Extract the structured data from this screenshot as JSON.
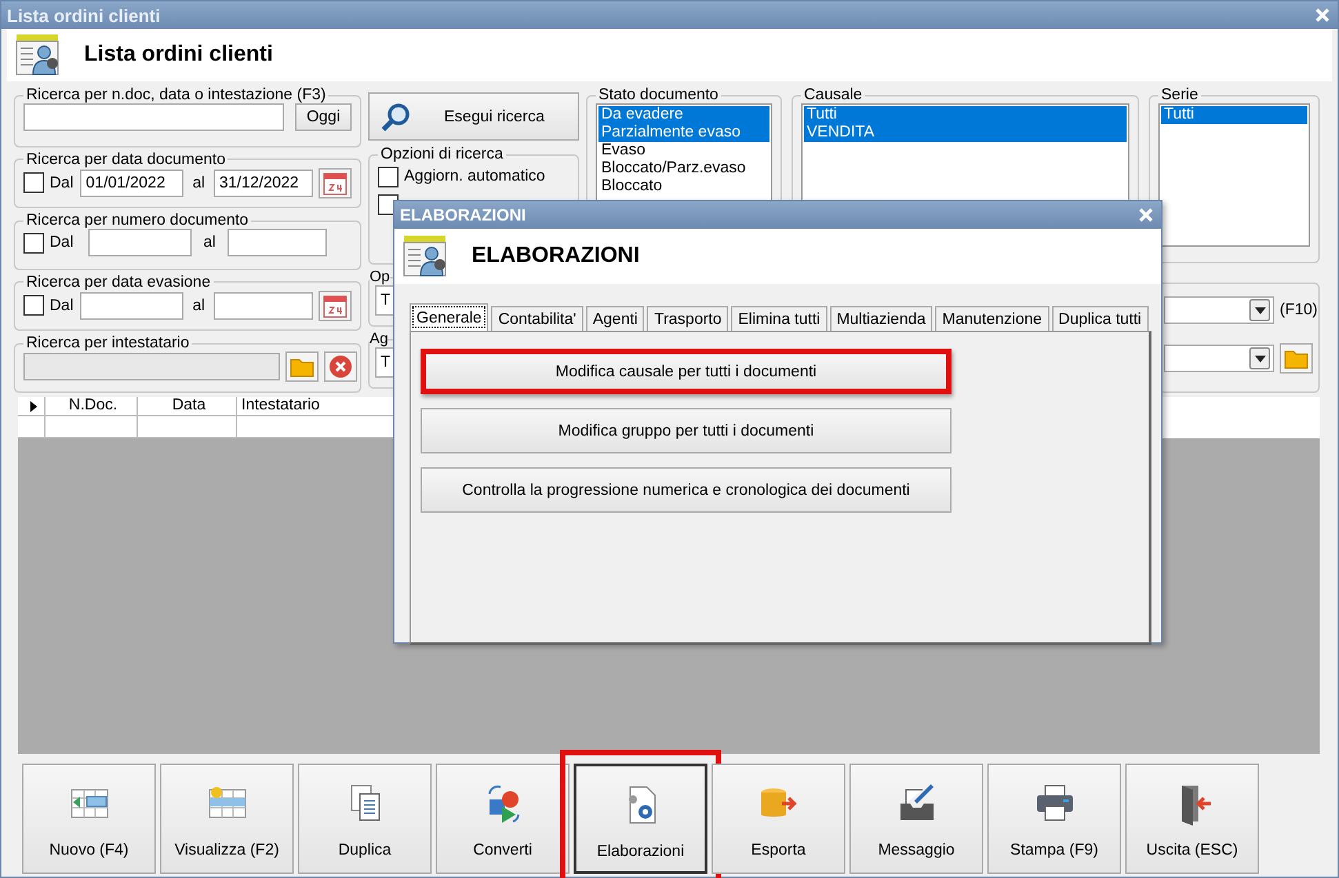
{
  "window": {
    "title": "Lista ordini clienti",
    "header": "Lista ordini clienti"
  },
  "quick_search": {
    "legend": "Ricerca per n.doc, data o intestazione (F3)",
    "button": "Oggi"
  },
  "range_groups": [
    {
      "legend": "Ricerca per data documento",
      "checkbox_label": "Dal",
      "checked": false,
      "from": "01/01/2022",
      "to_label": "al",
      "to": "31/12/2022",
      "calendar": true
    },
    {
      "legend": "Ricerca per numero documento",
      "checkbox_label": "Dal",
      "checked": false,
      "to_label": "al",
      "calendar": false
    },
    {
      "legend": "Ricerca per data evasione",
      "checkbox_label": "Dal",
      "checked": false,
      "to_label": "al",
      "calendar": true
    }
  ],
  "holder_search": {
    "legend": "Ricerca per intestatario"
  },
  "search_button": "Esegui ricerca",
  "search_options": {
    "legend": "Opzioni di ricerca",
    "items": [
      {
        "label": "Aggiorn. automatico",
        "checked": false
      },
      {
        "checked": false
      }
    ]
  },
  "cut_groups": [
    {
      "legend": "Op",
      "value": "T"
    },
    {
      "legend": "Ag",
      "value": "T"
    }
  ],
  "lists": [
    {
      "legend": "Stato documento",
      "items": [
        {
          "label": "Da evadere",
          "selected": true
        },
        {
          "label": "Parzialmente evaso",
          "selected": true
        },
        {
          "label": "Evaso",
          "selected": false
        },
        {
          "label": "Bloccato/Parz.evaso",
          "selected": false
        },
        {
          "label": "Bloccato",
          "selected": false
        }
      ]
    },
    {
      "legend": "Causale",
      "items": [
        {
          "label": "Tutti",
          "selected": true
        },
        {
          "label": "VENDITA",
          "selected": true
        }
      ]
    },
    {
      "legend": "Serie",
      "items": [
        {
          "label": "Tutti",
          "selected": true
        }
      ]
    }
  ],
  "filter_combos": [
    {
      "kind": "shortcut",
      "label": "(F10)"
    },
    {
      "kind": "folder"
    }
  ],
  "grid": {
    "columns": [
      "N.Doc.",
      "Data",
      "Intestatario"
    ]
  },
  "toolbar": [
    {
      "label": "Nuovo (F4)",
      "highlighted": false
    },
    {
      "label": "Visualizza (F2)",
      "highlighted": false
    },
    {
      "label": "Duplica",
      "highlighted": false
    },
    {
      "label": "Converti",
      "highlighted": false
    },
    {
      "label": "Elaborazioni",
      "highlighted": true
    },
    {
      "label": "Esporta",
      "highlighted": false
    },
    {
      "label": "Messaggio",
      "highlighted": false
    },
    {
      "label": "Stampa (F9)",
      "highlighted": false
    },
    {
      "label": "Uscita (ESC)",
      "highlighted": false
    }
  ],
  "dialog": {
    "title": "ELABORAZIONI",
    "header": "ELABORAZIONI",
    "tabs": [
      {
        "label": "Generale",
        "selected": true
      },
      {
        "label": "Contabilita'",
        "selected": false
      },
      {
        "label": "Agenti",
        "selected": false
      },
      {
        "label": "Trasporto",
        "selected": false
      },
      {
        "label": "Elimina tutti",
        "selected": false
      },
      {
        "label": "Multiazienda",
        "selected": false
      },
      {
        "label": "Manutenzione",
        "selected": false
      },
      {
        "label": "Duplica tutti",
        "selected": false
      }
    ],
    "buttons": [
      {
        "label": "Modifica causale per tutti i documenti",
        "highlighted": true
      },
      {
        "label": "Modifica gruppo per tutti i documenti",
        "highlighted": false
      },
      {
        "label": "Controlla la progressione numerica e cronologica dei documenti",
        "highlighted": false
      }
    ]
  }
}
